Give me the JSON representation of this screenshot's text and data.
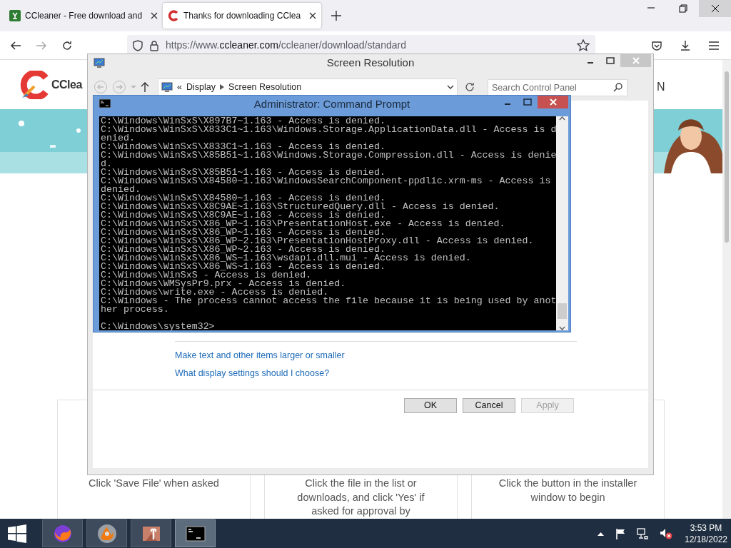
{
  "browser": {
    "tabs": [
      {
        "kind": "download",
        "title": "CCleaner - Free download and",
        "selected": false
      },
      {
        "kind": "ccleaner",
        "title": "Thanks for downloading CClea",
        "selected": true
      }
    ],
    "url": {
      "scheme": "https://www.",
      "domain": "ccleaner.com",
      "path": "/ccleaner/download/standard"
    }
  },
  "page": {
    "logo_text": "CClea",
    "nav_fragment": "N",
    "steps": [
      "Click 'Save File' when asked",
      "Click the file in the list or downloads, and click 'Yes' if asked for approval by",
      "Click the button in the installer window to begin"
    ]
  },
  "control_panel": {
    "title": "Screen Resolution",
    "breadcrumb_prefix": "«",
    "breadcrumb": [
      "Display",
      "Screen Resolution"
    ],
    "search": {
      "placeholder": "Search Control Panel"
    },
    "links": [
      "Make text and other items larger or smaller",
      "What display settings should I choose?"
    ],
    "buttons": [
      {
        "label": "OK",
        "disabled": false
      },
      {
        "label": "Cancel",
        "disabled": false
      },
      {
        "label": "Apply",
        "disabled": true
      }
    ]
  },
  "console": {
    "title": "Administrator: Command Prompt",
    "lines": [
      "C:\\Windows\\WinSxS\\X897B7~1.163 - Access is denied.",
      "C:\\Windows\\WinSxS\\X833C1~1.163\\Windows.Storage.ApplicationData.dll - Access is d",
      "enied.",
      "C:\\Windows\\WinSxS\\X833C1~1.163 - Access is denied.",
      "C:\\Windows\\WinSxS\\X85B51~1.163\\Windows.Storage.Compression.dll - Access is denie",
      "d.",
      "C:\\Windows\\WinSxS\\X85B51~1.163 - Access is denied.",
      "C:\\Windows\\WinSxS\\X84580~1.163\\WindowsSearchComponent-ppdlic.xrm-ms - Access is",
      "denied.",
      "C:\\Windows\\WinSxS\\X84580~1.163 - Access is denied.",
      "C:\\Windows\\WinSxS\\X8C9AE~1.163\\StructuredQuery.dll - Access is denied.",
      "C:\\Windows\\WinSxS\\X8C9AE~1.163 - Access is denied.",
      "C:\\Windows\\WinSxS\\X86_WP~1.163\\PresentationHost.exe - Access is denied.",
      "C:\\Windows\\WinSxS\\X86_WP~1.163 - Access is denied.",
      "C:\\Windows\\WinSxS\\X86_WP~2.163\\PresentationHostProxy.dll - Access is denied.",
      "C:\\Windows\\WinSxS\\X86_WP~2.163 - Access is denied.",
      "C:\\Windows\\WinSxS\\X86_WS~1.163\\wsdapi.dll.mui - Access is denied.",
      "C:\\Windows\\WinSxS\\X86_WS~1.163 - Access is denied.",
      "C:\\Windows\\WinSxS - Access is denied.",
      "C:\\Windows\\WMSysPr9.prx - Access is denied.",
      "C:\\Windows\\write.exe - Access is denied.",
      "C:\\Windows - The process cannot access the file because it is being used by anot",
      "her process."
    ],
    "prompt": "C:\\Windows\\system32>"
  },
  "taskbar": {
    "apps": [
      {
        "kind": "firefox",
        "selected": false
      },
      {
        "kind": "disc",
        "selected": false
      },
      {
        "kind": "tools",
        "selected": false
      },
      {
        "kind": "console",
        "selected": true
      }
    ],
    "time": "3:53 PM",
    "date": "12/18/2022"
  }
}
